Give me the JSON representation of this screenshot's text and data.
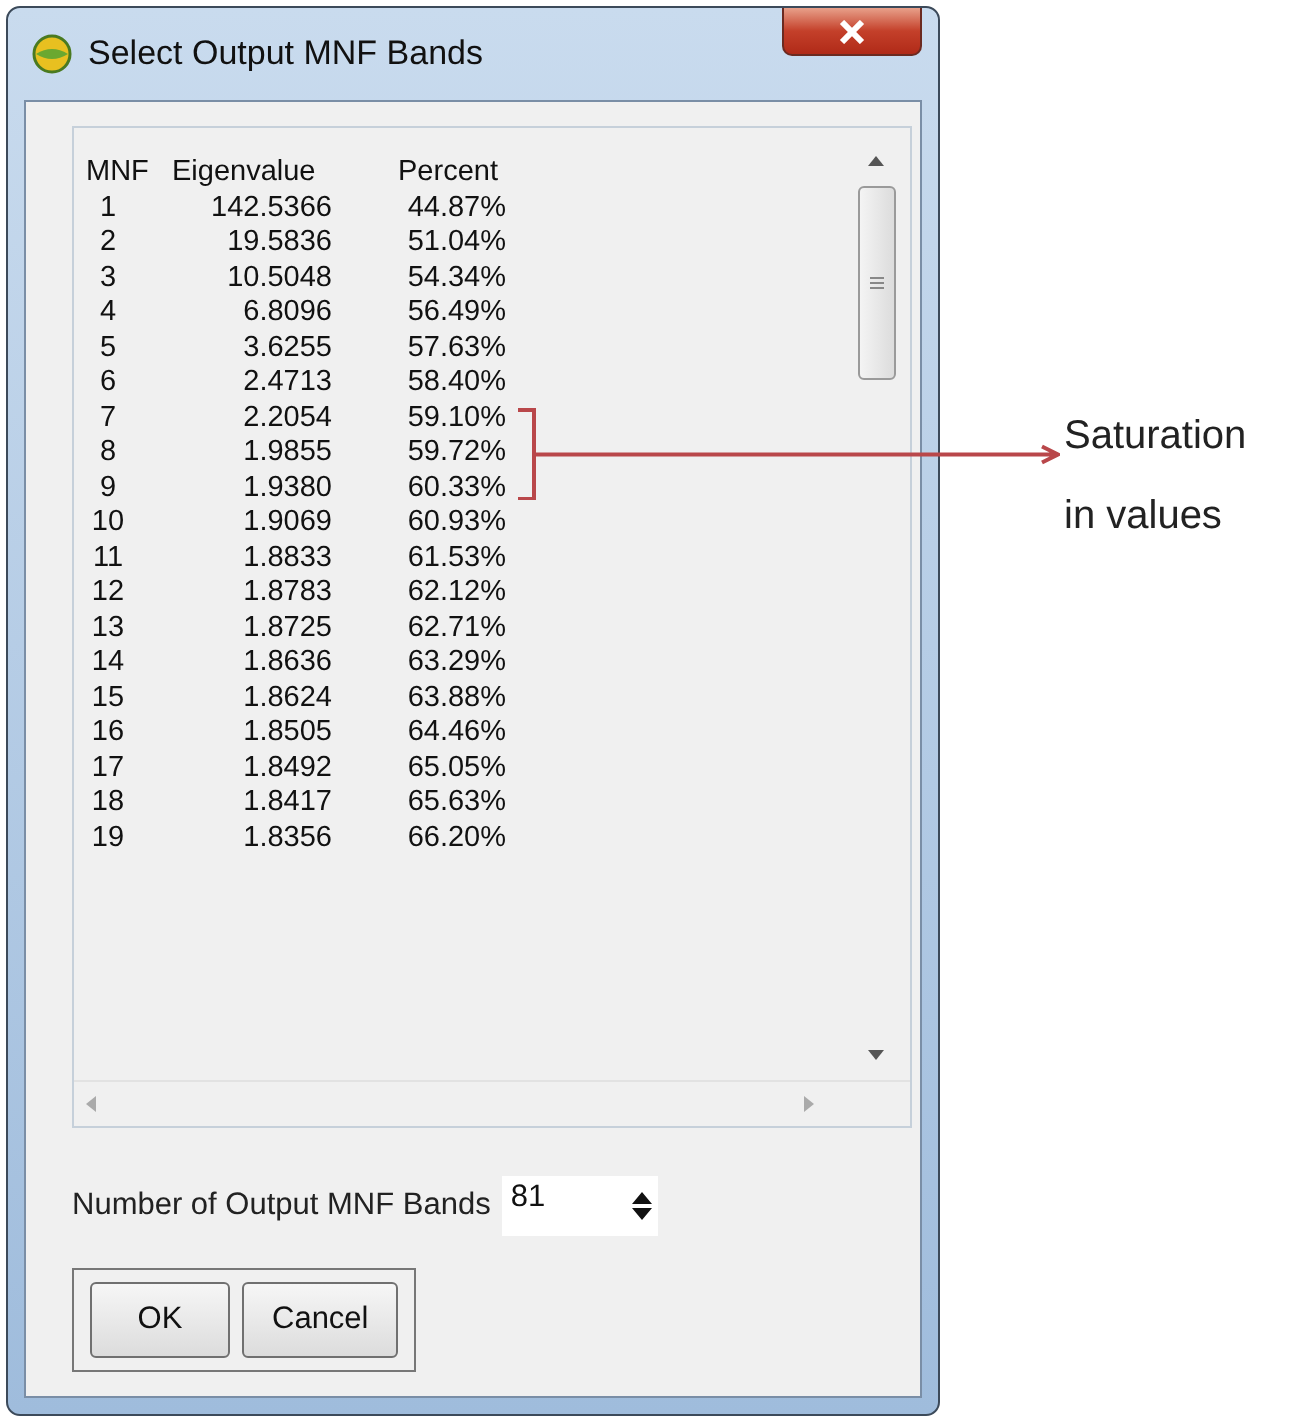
{
  "window": {
    "title": "Select Output MNF Bands"
  },
  "table": {
    "columns": [
      "MNF",
      "Eigenvalue",
      "Percent"
    ],
    "rows": [
      {
        "mnf": "1",
        "eigenvalue": "142.5366",
        "percent": "44.87%",
        "bracketed": false
      },
      {
        "mnf": "2",
        "eigenvalue": "19.5836",
        "percent": "51.04%",
        "bracketed": false
      },
      {
        "mnf": "3",
        "eigenvalue": "10.5048",
        "percent": "54.34%",
        "bracketed": false
      },
      {
        "mnf": "4",
        "eigenvalue": "6.8096",
        "percent": "56.49%",
        "bracketed": false
      },
      {
        "mnf": "5",
        "eigenvalue": "3.6255",
        "percent": "57.63%",
        "bracketed": false
      },
      {
        "mnf": "6",
        "eigenvalue": "2.4713",
        "percent": "58.40%",
        "bracketed": false
      },
      {
        "mnf": "7",
        "eigenvalue": "2.2054",
        "percent": "59.10%",
        "bracketed": true
      },
      {
        "mnf": "8",
        "eigenvalue": "1.9855",
        "percent": "59.72%",
        "bracketed": true
      },
      {
        "mnf": "9",
        "eigenvalue": "1.9380",
        "percent": "60.33%",
        "bracketed": true
      },
      {
        "mnf": "10",
        "eigenvalue": "1.9069",
        "percent": "60.93%",
        "bracketed": false
      },
      {
        "mnf": "11",
        "eigenvalue": "1.8833",
        "percent": "61.53%",
        "bracketed": false
      },
      {
        "mnf": "12",
        "eigenvalue": "1.8783",
        "percent": "62.12%",
        "bracketed": false
      },
      {
        "mnf": "13",
        "eigenvalue": "1.8725",
        "percent": "62.71%",
        "bracketed": false
      },
      {
        "mnf": "14",
        "eigenvalue": "1.8636",
        "percent": "63.29%",
        "bracketed": false
      },
      {
        "mnf": "15",
        "eigenvalue": "1.8624",
        "percent": "63.88%",
        "bracketed": false
      },
      {
        "mnf": "16",
        "eigenvalue": "1.8505",
        "percent": "64.46%",
        "bracketed": false
      },
      {
        "mnf": "17",
        "eigenvalue": "1.8492",
        "percent": "65.05%",
        "bracketed": false
      },
      {
        "mnf": "18",
        "eigenvalue": "1.8417",
        "percent": "65.63%",
        "bracketed": false
      },
      {
        "mnf": "19",
        "eigenvalue": "1.8356",
        "percent": "66.20%",
        "bracketed": false
      }
    ]
  },
  "band_count": {
    "label": "Number of Output MNF Bands",
    "value": "81"
  },
  "buttons": [
    "OK",
    "Cancel"
  ],
  "annotation": {
    "text": "Saturation in values"
  }
}
